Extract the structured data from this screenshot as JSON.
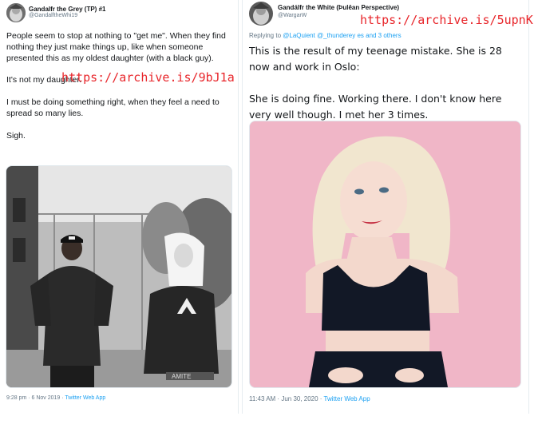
{
  "left_tweet": {
    "display_name": "Gandalfr the Grey (TP) #1",
    "handle": "@GandalftheWhi19",
    "paragraphs": [
      "People seem to stop at nothing to \"get me\". When they find nothing they just make things up, like when someone presented this as my oldest daughter (with a black guy).",
      "It's not my daughter.",
      "I must be doing something right, when they feel a need to spread so many lies.",
      "Sigh."
    ],
    "archive_link": "https://archive.is/9bJ1a",
    "timestamp": "9:28 pm · 6 Nov 2019 · ",
    "source_app": "Twitter Web App"
  },
  "right_tweet": {
    "display_name": "Gandálfr the White (Þulêan Perspective)",
    "handle": "@WargarW",
    "replying_prefix": "Replying to ",
    "replying_mentions": "@LaQuient @_thunderey es",
    "replying_suffix": " and 3 others",
    "paragraphs": [
      "This is the result of my teenage mistake. She is 28 now and work in Oslo:",
      "She is doing fine. Working there. I don't know here very well though. I met her 3 times."
    ],
    "archive_link": "https://archive.is/5upnK",
    "timestamp": "11:43 AM · Jun 30, 2020 · ",
    "source_app": "Twitter Web App"
  },
  "colors": {
    "link_blue": "#1da1f2",
    "archive_red": "#e8262b",
    "muted_gray": "#657786",
    "photo_pink": "#f0b6c7"
  }
}
